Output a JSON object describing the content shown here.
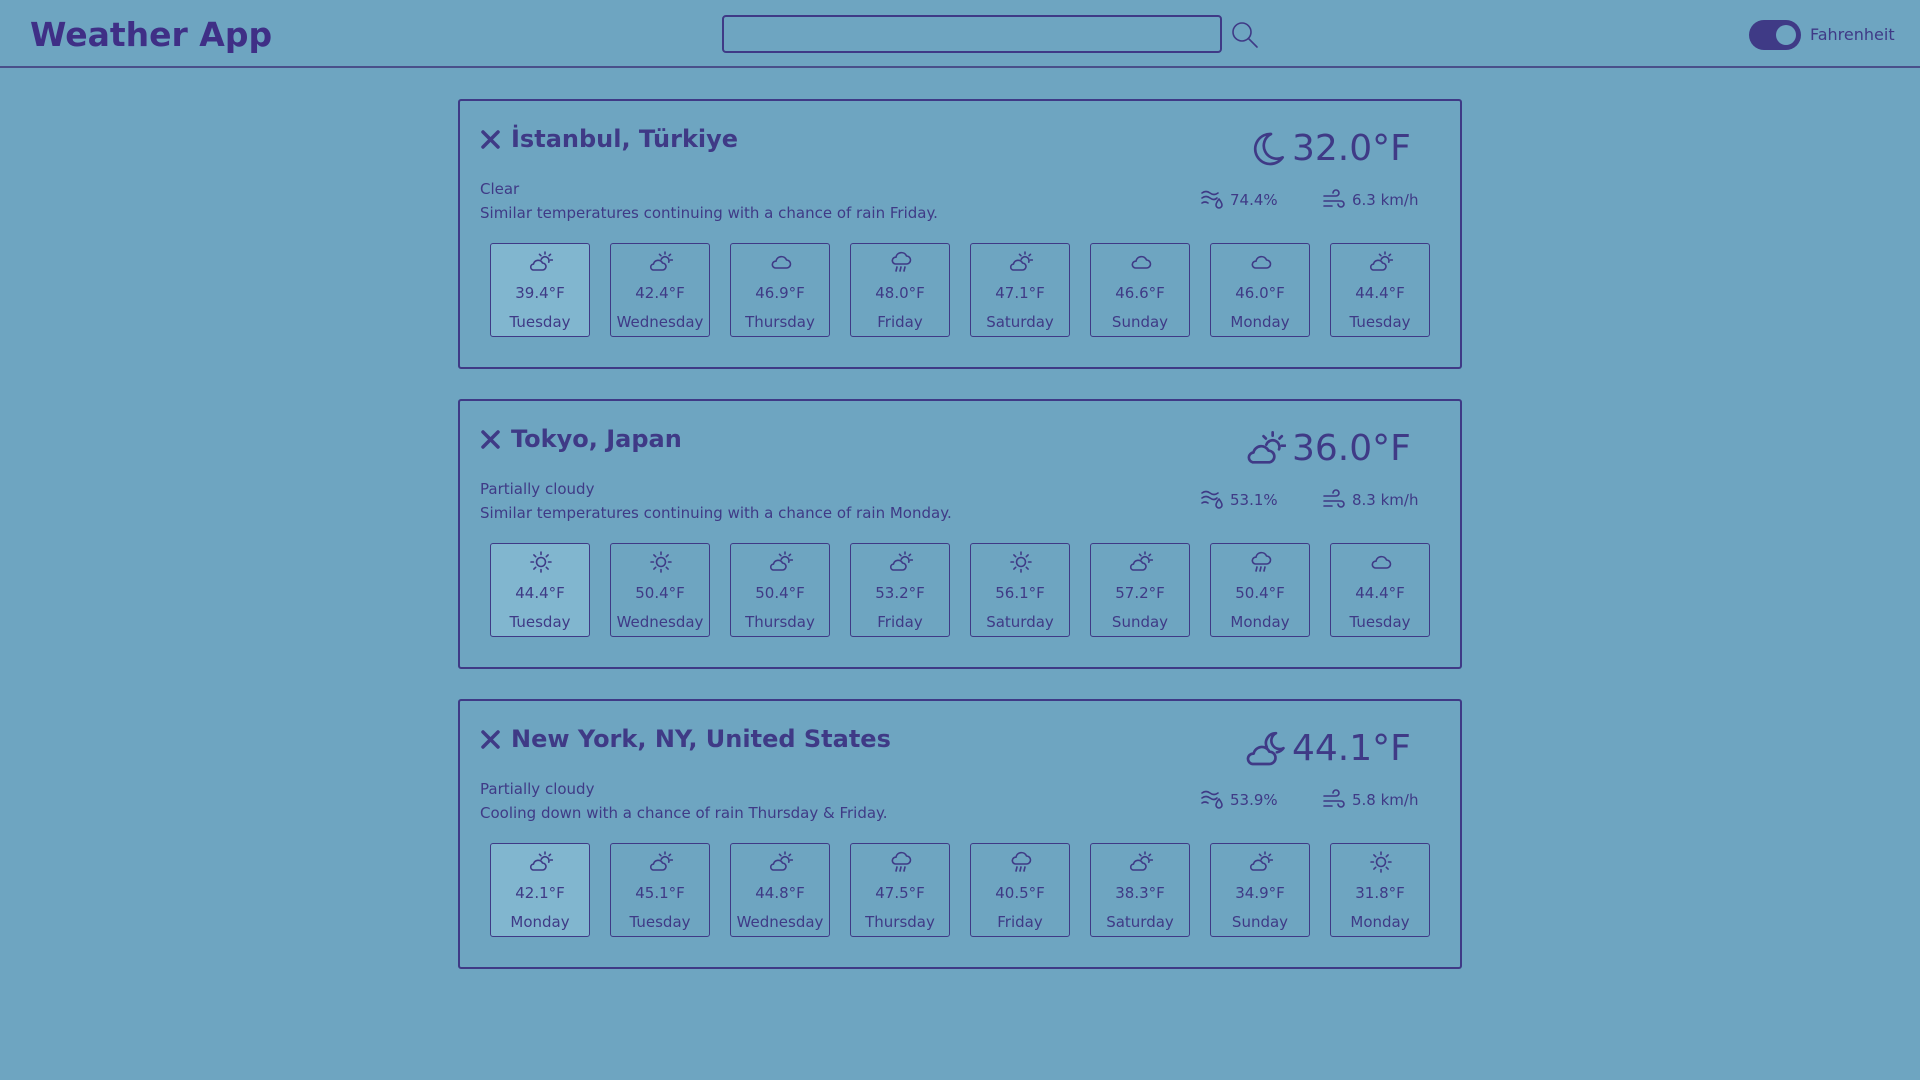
{
  "app": {
    "title": "Weather App"
  },
  "search": {
    "value": "",
    "placeholder": ""
  },
  "unit_toggle": {
    "label": "Fahrenheit",
    "on": true
  },
  "colors": {
    "background": "#6ea5c1",
    "accent": "#3f3a86",
    "active_day": "#81b6cf"
  },
  "cities": [
    {
      "name": "İstanbul, Türkiye",
      "condition": "Clear",
      "description": "Similar temperatures continuing with a chance of rain Friday.",
      "current_icon": "moon-icon",
      "current_temp": "32.0°F",
      "humidity": "74.4%",
      "wind": "6.3 km/h",
      "forecast": [
        {
          "temp": "39.4°F",
          "day": "Tuesday",
          "icon": "partly-cloudy-icon",
          "active": true
        },
        {
          "temp": "42.4°F",
          "day": "Wednesday",
          "icon": "partly-cloudy-icon"
        },
        {
          "temp": "46.9°F",
          "day": "Thursday",
          "icon": "cloud-icon"
        },
        {
          "temp": "48.0°F",
          "day": "Friday",
          "icon": "rain-icon"
        },
        {
          "temp": "47.1°F",
          "day": "Saturday",
          "icon": "partly-cloudy-icon"
        },
        {
          "temp": "46.6°F",
          "day": "Sunday",
          "icon": "cloud-icon"
        },
        {
          "temp": "46.0°F",
          "day": "Monday",
          "icon": "cloud-icon"
        },
        {
          "temp": "44.4°F",
          "day": "Tuesday",
          "icon": "partly-cloudy-icon"
        }
      ]
    },
    {
      "name": "Tokyo, Japan",
      "condition": "Partially cloudy",
      "description": "Similar temperatures continuing with a chance of rain Monday.",
      "current_icon": "partly-cloudy-icon",
      "current_temp": "36.0°F",
      "humidity": "53.1%",
      "wind": "8.3 km/h",
      "forecast": [
        {
          "temp": "44.4°F",
          "day": "Tuesday",
          "icon": "sun-icon",
          "active": true
        },
        {
          "temp": "50.4°F",
          "day": "Wednesday",
          "icon": "sun-icon"
        },
        {
          "temp": "50.4°F",
          "day": "Thursday",
          "icon": "partly-cloudy-icon"
        },
        {
          "temp": "53.2°F",
          "day": "Friday",
          "icon": "partly-cloudy-icon"
        },
        {
          "temp": "56.1°F",
          "day": "Saturday",
          "icon": "sun-icon"
        },
        {
          "temp": "57.2°F",
          "day": "Sunday",
          "icon": "partly-cloudy-icon"
        },
        {
          "temp": "50.4°F",
          "day": "Monday",
          "icon": "rain-icon"
        },
        {
          "temp": "44.4°F",
          "day": "Tuesday",
          "icon": "cloud-icon"
        }
      ]
    },
    {
      "name": "New York, NY, United States",
      "condition": "Partially cloudy",
      "description": "Cooling down with a chance of rain Thursday & Friday.",
      "current_icon": "cloudy-night-icon",
      "current_temp": "44.1°F",
      "humidity": "53.9%",
      "wind": "5.8 km/h",
      "forecast": [
        {
          "temp": "42.1°F",
          "day": "Monday",
          "icon": "partly-cloudy-icon",
          "active": true
        },
        {
          "temp": "45.1°F",
          "day": "Tuesday",
          "icon": "partly-cloudy-icon"
        },
        {
          "temp": "44.8°F",
          "day": "Wednesday",
          "icon": "partly-cloudy-icon"
        },
        {
          "temp": "47.5°F",
          "day": "Thursday",
          "icon": "rain-icon"
        },
        {
          "temp": "40.5°F",
          "day": "Friday",
          "icon": "rain-icon"
        },
        {
          "temp": "38.3°F",
          "day": "Saturday",
          "icon": "partly-cloudy-icon"
        },
        {
          "temp": "34.9°F",
          "day": "Sunday",
          "icon": "partly-cloudy-icon"
        },
        {
          "temp": "31.8°F",
          "day": "Monday",
          "icon": "sun-icon"
        }
      ]
    }
  ]
}
